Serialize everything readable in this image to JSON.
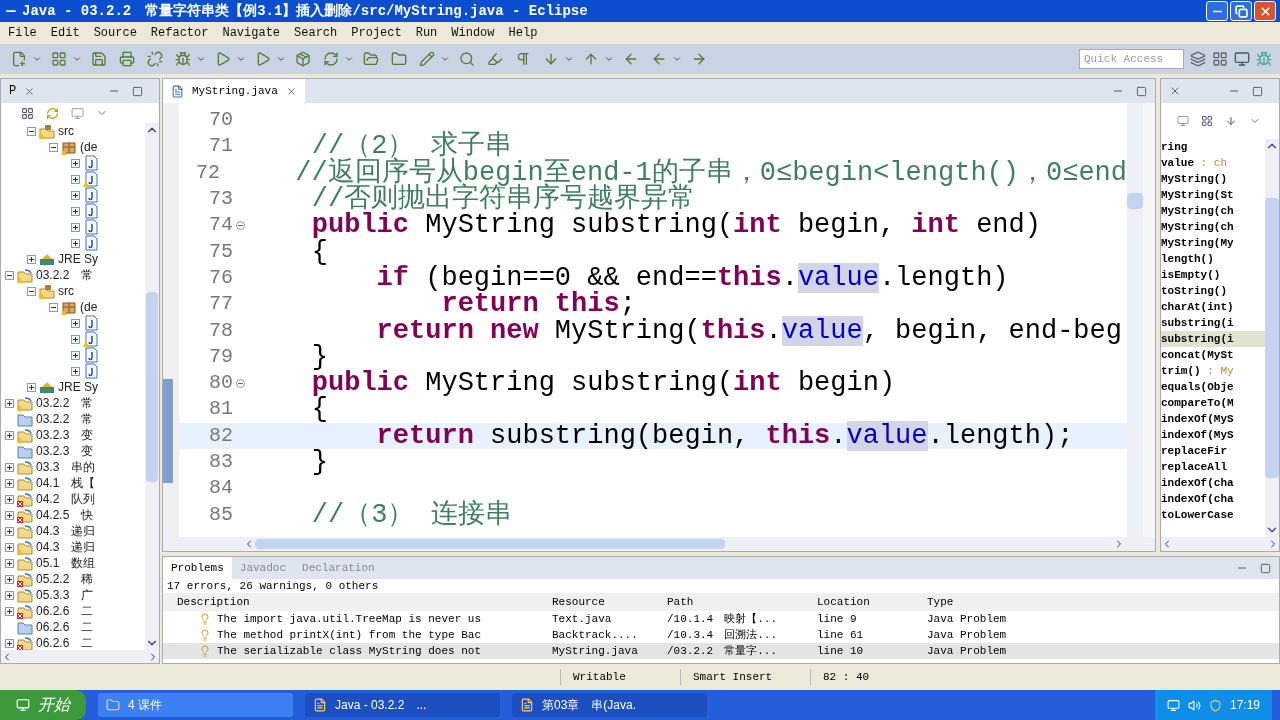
{
  "window": {
    "title": "Java - 03.2.2　常量字符串类【例3.1】插入删除/src/MyString.java - Eclipse"
  },
  "menu": [
    "File",
    "Edit",
    "Source",
    "Refactor",
    "Navigate",
    "Search",
    "Project",
    "Run",
    "Window",
    "Help"
  ],
  "quick_access": {
    "placeholder": "Quick Access"
  },
  "explorer": {
    "tab": "P",
    "scrolled_children": [
      {
        "kind": "source_folder",
        "label": "src",
        "expanded": true,
        "warning": true,
        "error": false,
        "children": [
          {
            "kind": "package",
            "label": "(de",
            "expanded": true,
            "warning": true,
            "error": false,
            "children": [
              {
                "kind": "file",
                "expanded": false,
                "warning": false,
                "error": false
              },
              {
                "kind": "file",
                "expanded": false,
                "warning": true,
                "error": false
              },
              {
                "kind": "file",
                "expanded": false,
                "warning": false,
                "error": false
              },
              {
                "kind": "file",
                "expanded": false,
                "warning": false,
                "error": false
              },
              {
                "kind": "file",
                "expanded": false,
                "warning": false,
                "error": false
              },
              {
                "kind": "file",
                "expanded": false,
                "warning": false,
                "error": false
              }
            ]
          }
        ]
      },
      {
        "kind": "library",
        "label": "JRE Sy",
        "expanded": false,
        "warning": false,
        "error": false
      }
    ],
    "items": [
      {
        "kind": "project",
        "label": "03.2.2　常",
        "expanded": true,
        "warning": true,
        "error": false,
        "children": [
          {
            "kind": "source_folder",
            "label": "src",
            "expanded": true,
            "warning": true,
            "error": false,
            "children": [
              {
                "kind": "package",
                "label": "(de",
                "expanded": true,
                "warning": true,
                "error": false,
                "children": [
                  {
                    "kind": "file",
                    "expanded": false,
                    "warning": false,
                    "error": false
                  },
                  {
                    "kind": "file",
                    "expanded": false,
                    "warning": true,
                    "error": false
                  },
                  {
                    "kind": "file",
                    "expanded": false,
                    "warning": false,
                    "error": false
                  },
                  {
                    "kind": "file",
                    "expanded": false,
                    "warning": false,
                    "error": false
                  }
                ]
              }
            ]
          },
          {
            "kind": "library",
            "label": "JRE Sy",
            "expanded": false,
            "warning": false,
            "error": false
          }
        ]
      },
      {
        "kind": "project",
        "label": "03.2.2　常",
        "expanded": false,
        "warning": true,
        "error": false
      },
      {
        "kind": "closed_project",
        "label": "03.2.2　常",
        "warning": false,
        "error": false
      },
      {
        "kind": "project",
        "label": "03.2.3　变",
        "expanded": false,
        "warning": true,
        "error": false
      },
      {
        "kind": "closed_project",
        "label": "03.2.3　变",
        "warning": false,
        "error": false
      },
      {
        "kind": "project",
        "label": "03.3　串的",
        "expanded": false,
        "warning": false,
        "error": false
      },
      {
        "kind": "project",
        "label": "04.1　栈【",
        "expanded": false,
        "warning": false,
        "error": false
      },
      {
        "kind": "project",
        "label": "04.2　队列",
        "expanded": false,
        "warning": false,
        "error": true
      },
      {
        "kind": "project",
        "label": "04.2.5　快",
        "expanded": false,
        "warning": false,
        "error": true
      },
      {
        "kind": "project",
        "label": "04.3　递归",
        "expanded": false,
        "warning": false,
        "error": false
      },
      {
        "kind": "project",
        "label": "04.3　递归",
        "expanded": false,
        "warning": true,
        "error": false
      },
      {
        "kind": "project",
        "label": "05.1　数组",
        "expanded": false,
        "warning": false,
        "error": false
      },
      {
        "kind": "project",
        "label": "05.2.2　稀",
        "expanded": false,
        "warning": false,
        "error": true
      },
      {
        "kind": "project",
        "label": "05.3.3　广",
        "expanded": false,
        "warning": false,
        "error": false
      },
      {
        "kind": "project",
        "label": "06.2.6　二",
        "expanded": false,
        "warning": false,
        "error": true
      },
      {
        "kind": "closed_project",
        "label": "06.2.6　二",
        "warning": false,
        "error": false
      },
      {
        "kind": "project",
        "label": "06.2.6　二",
        "expanded": false,
        "warning": false,
        "error": true
      }
    ]
  },
  "editor": {
    "tab": "MyString.java",
    "lines": [
      {
        "number": "70",
        "current": false,
        "fold": false
      },
      {
        "number": "71",
        "current": false,
        "fold": false,
        "tokens": [
          {
            "t": "    //（2） 求子串",
            "kind": "comment"
          }
        ]
      },
      {
        "number": "72",
        "current": false,
        "fold": false,
        "tokens": [
          {
            "t": "    //返回序号从begin至end-1的子串，0≤begin<length()，0≤end",
            "kind": "comment"
          }
        ]
      },
      {
        "number": "73",
        "current": false,
        "fold": false,
        "tokens": [
          {
            "t": "    //否则抛出字符串序号越界异常",
            "kind": "comment"
          }
        ]
      },
      {
        "number": "74",
        "current": false,
        "fold": true,
        "tokens": [
          {
            "t": "    public",
            "kind": "keyword"
          },
          {
            "t": " MyString substring(",
            "kind": "plain"
          },
          {
            "t": "int",
            "kind": "keyword"
          },
          {
            "t": " begin, ",
            "kind": "plain"
          },
          {
            "t": "int",
            "kind": "keyword"
          },
          {
            "t": " end)",
            "kind": "plain"
          }
        ]
      },
      {
        "number": "75",
        "current": false,
        "fold": false,
        "tokens": [
          {
            "t": "    {",
            "kind": "plain"
          }
        ]
      },
      {
        "number": "76",
        "current": false,
        "fold": false,
        "tokens": [
          {
            "t": "        if",
            "kind": "keyword"
          },
          {
            "t": " (begin==0 && end==",
            "kind": "plain"
          },
          {
            "t": "this",
            "kind": "keyword"
          },
          {
            "t": ".",
            "kind": "plain"
          },
          {
            "t": "value",
            "kind": "occurrence"
          },
          {
            "t": ".length)",
            "kind": "plain"
          }
        ]
      },
      {
        "number": "77",
        "current": false,
        "fold": false,
        "tokens": [
          {
            "t": "            return this",
            "kind": "keyword"
          },
          {
            "t": ";",
            "kind": "plain"
          }
        ]
      },
      {
        "number": "78",
        "current": false,
        "fold": false,
        "tokens": [
          {
            "t": "        return new",
            "kind": "keyword"
          },
          {
            "t": " MyString(",
            "kind": "plain"
          },
          {
            "t": "this",
            "kind": "keyword"
          },
          {
            "t": ".",
            "kind": "plain"
          },
          {
            "t": "value",
            "kind": "occurrence"
          },
          {
            "t": ", begin, end-beg",
            "kind": "plain"
          }
        ]
      },
      {
        "number": "79",
        "current": false,
        "fold": false,
        "tokens": [
          {
            "t": "    }",
            "kind": "plain"
          }
        ]
      },
      {
        "number": "80",
        "current": false,
        "fold": true,
        "tokens": [
          {
            "t": "    public",
            "kind": "keyword"
          },
          {
            "t": " MyString substring(",
            "kind": "plain"
          },
          {
            "t": "int",
            "kind": "keyword"
          },
          {
            "t": " begin)",
            "kind": "plain"
          }
        ]
      },
      {
        "number": "81",
        "current": false,
        "fold": false,
        "tokens": [
          {
            "t": "    {",
            "kind": "plain"
          }
        ]
      },
      {
        "number": "82",
        "current": true,
        "fold": false,
        "tokens": [
          {
            "t": "        return",
            "kind": "keyword"
          },
          {
            "t": " substring(begin, ",
            "kind": "plain"
          },
          {
            "t": "this",
            "kind": "keyword"
          },
          {
            "t": ".",
            "kind": "plain"
          },
          {
            "t": "value",
            "kind": "occurrence"
          },
          {
            "t": ".length);",
            "kind": "plain"
          }
        ]
      },
      {
        "number": "83",
        "current": false,
        "fold": false,
        "tokens": [
          {
            "t": "    }",
            "kind": "plain"
          }
        ]
      },
      {
        "number": "84",
        "current": false,
        "fold": false
      },
      {
        "number": "85",
        "current": false,
        "fold": false,
        "tokens": [
          {
            "t": "    //（3） 连接串",
            "kind": "comment"
          }
        ]
      }
    ]
  },
  "outline": {
    "items": [
      {
        "name": "ring",
        "selected": false
      },
      {
        "name": "value",
        "type": " : ch",
        "selected": false
      },
      {
        "name": "MyString()",
        "selected": false
      },
      {
        "name": "MyString(St",
        "selected": false
      },
      {
        "name": "MyString(ch",
        "selected": false
      },
      {
        "name": "MyString(ch",
        "selected": false
      },
      {
        "name": "MyString(My",
        "selected": false
      },
      {
        "name": "length()",
        "selected": false
      },
      {
        "name": "isEmpty()",
        "selected": false
      },
      {
        "name": "toString()",
        "selected": false
      },
      {
        "name": "charAt(int)",
        "selected": false
      },
      {
        "name": "substring(i",
        "selected": false
      },
      {
        "name": "substring(i",
        "selected": true
      },
      {
        "name": "concat(MySt",
        "selected": false
      },
      {
        "name": "trim()",
        "type": " : My",
        "selected": false
      },
      {
        "name": "equals(Obje",
        "selected": false
      },
      {
        "name": "compareTo(M",
        "selected": false
      },
      {
        "name": "indexOf(MyS",
        "selected": false
      },
      {
        "name": "indexOf(MyS",
        "selected": false
      },
      {
        "name": "replaceFir",
        "selected": false
      },
      {
        "name": "replaceAll",
        "selected": false
      },
      {
        "name": "indexOf(cha",
        "selected": false
      },
      {
        "name": "indexOf(cha",
        "selected": false
      },
      {
        "name": "toLowerCase",
        "selected": false
      }
    ]
  },
  "problems": {
    "tabs": [
      {
        "label": "Problems",
        "selected": true
      },
      {
        "label": "Javadoc",
        "selected": false
      },
      {
        "label": "Declaration",
        "selected": false
      }
    ],
    "summary": "17 errors, 26 warnings, 0 others",
    "columns": [
      "Description",
      "Resource",
      "Path",
      "Location",
      "Type"
    ],
    "rows": [
      {
        "cells": [
          "The import java.util.TreeMap is never us",
          "Text.java",
          "/10.1.4　映射【...",
          "line 9",
          "Java Problem"
        ],
        "selected": false
      },
      {
        "cells": [
          "The method printX(int) from the type Bac",
          "Backtrack....",
          "/10.3.4　回溯法...",
          "line 61",
          "Java Problem"
        ],
        "selected": false
      },
      {
        "cells": [
          "The serializable class MyString does not",
          "MyString.java",
          "/03.2.2　常量字...",
          "line 10",
          "Java Problem"
        ],
        "selected": true
      }
    ]
  },
  "status_bar": [
    "Writable",
    "Smart Insert",
    "82 : 40"
  ],
  "taskbar": {
    "start": "开始",
    "tasks": [
      "4 课件",
      "Java - 03.2.2　...",
      "第03章　串(Java."
    ],
    "clock": "17:19"
  }
}
